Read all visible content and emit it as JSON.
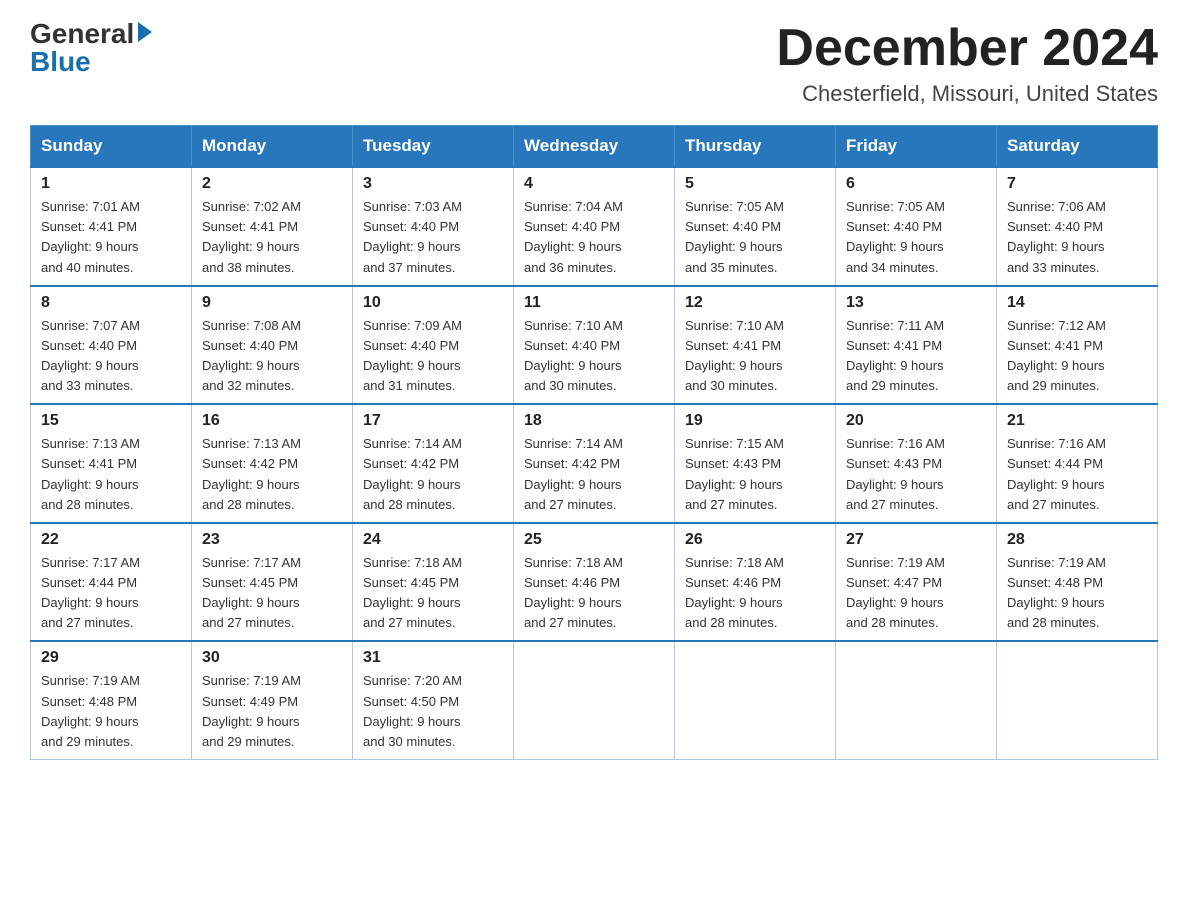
{
  "logo": {
    "general": "General",
    "blue": "Blue"
  },
  "title": {
    "month": "December 2024",
    "location": "Chesterfield, Missouri, United States"
  },
  "weekdays": [
    "Sunday",
    "Monday",
    "Tuesday",
    "Wednesday",
    "Thursday",
    "Friday",
    "Saturday"
  ],
  "weeks": [
    [
      {
        "day": "1",
        "sunrise": "7:01 AM",
        "sunset": "4:41 PM",
        "daylight": "9 hours and 40 minutes."
      },
      {
        "day": "2",
        "sunrise": "7:02 AM",
        "sunset": "4:41 PM",
        "daylight": "9 hours and 38 minutes."
      },
      {
        "day": "3",
        "sunrise": "7:03 AM",
        "sunset": "4:40 PM",
        "daylight": "9 hours and 37 minutes."
      },
      {
        "day": "4",
        "sunrise": "7:04 AM",
        "sunset": "4:40 PM",
        "daylight": "9 hours and 36 minutes."
      },
      {
        "day": "5",
        "sunrise": "7:05 AM",
        "sunset": "4:40 PM",
        "daylight": "9 hours and 35 minutes."
      },
      {
        "day": "6",
        "sunrise": "7:05 AM",
        "sunset": "4:40 PM",
        "daylight": "9 hours and 34 minutes."
      },
      {
        "day": "7",
        "sunrise": "7:06 AM",
        "sunset": "4:40 PM",
        "daylight": "9 hours and 33 minutes."
      }
    ],
    [
      {
        "day": "8",
        "sunrise": "7:07 AM",
        "sunset": "4:40 PM",
        "daylight": "9 hours and 33 minutes."
      },
      {
        "day": "9",
        "sunrise": "7:08 AM",
        "sunset": "4:40 PM",
        "daylight": "9 hours and 32 minutes."
      },
      {
        "day": "10",
        "sunrise": "7:09 AM",
        "sunset": "4:40 PM",
        "daylight": "9 hours and 31 minutes."
      },
      {
        "day": "11",
        "sunrise": "7:10 AM",
        "sunset": "4:40 PM",
        "daylight": "9 hours and 30 minutes."
      },
      {
        "day": "12",
        "sunrise": "7:10 AM",
        "sunset": "4:41 PM",
        "daylight": "9 hours and 30 minutes."
      },
      {
        "day": "13",
        "sunrise": "7:11 AM",
        "sunset": "4:41 PM",
        "daylight": "9 hours and 29 minutes."
      },
      {
        "day": "14",
        "sunrise": "7:12 AM",
        "sunset": "4:41 PM",
        "daylight": "9 hours and 29 minutes."
      }
    ],
    [
      {
        "day": "15",
        "sunrise": "7:13 AM",
        "sunset": "4:41 PM",
        "daylight": "9 hours and 28 minutes."
      },
      {
        "day": "16",
        "sunrise": "7:13 AM",
        "sunset": "4:42 PM",
        "daylight": "9 hours and 28 minutes."
      },
      {
        "day": "17",
        "sunrise": "7:14 AM",
        "sunset": "4:42 PM",
        "daylight": "9 hours and 28 minutes."
      },
      {
        "day": "18",
        "sunrise": "7:14 AM",
        "sunset": "4:42 PM",
        "daylight": "9 hours and 27 minutes."
      },
      {
        "day": "19",
        "sunrise": "7:15 AM",
        "sunset": "4:43 PM",
        "daylight": "9 hours and 27 minutes."
      },
      {
        "day": "20",
        "sunrise": "7:16 AM",
        "sunset": "4:43 PM",
        "daylight": "9 hours and 27 minutes."
      },
      {
        "day": "21",
        "sunrise": "7:16 AM",
        "sunset": "4:44 PM",
        "daylight": "9 hours and 27 minutes."
      }
    ],
    [
      {
        "day": "22",
        "sunrise": "7:17 AM",
        "sunset": "4:44 PM",
        "daylight": "9 hours and 27 minutes."
      },
      {
        "day": "23",
        "sunrise": "7:17 AM",
        "sunset": "4:45 PM",
        "daylight": "9 hours and 27 minutes."
      },
      {
        "day": "24",
        "sunrise": "7:18 AM",
        "sunset": "4:45 PM",
        "daylight": "9 hours and 27 minutes."
      },
      {
        "day": "25",
        "sunrise": "7:18 AM",
        "sunset": "4:46 PM",
        "daylight": "9 hours and 27 minutes."
      },
      {
        "day": "26",
        "sunrise": "7:18 AM",
        "sunset": "4:46 PM",
        "daylight": "9 hours and 28 minutes."
      },
      {
        "day": "27",
        "sunrise": "7:19 AM",
        "sunset": "4:47 PM",
        "daylight": "9 hours and 28 minutes."
      },
      {
        "day": "28",
        "sunrise": "7:19 AM",
        "sunset": "4:48 PM",
        "daylight": "9 hours and 28 minutes."
      }
    ],
    [
      {
        "day": "29",
        "sunrise": "7:19 AM",
        "sunset": "4:48 PM",
        "daylight": "9 hours and 29 minutes."
      },
      {
        "day": "30",
        "sunrise": "7:19 AM",
        "sunset": "4:49 PM",
        "daylight": "9 hours and 29 minutes."
      },
      {
        "day": "31",
        "sunrise": "7:20 AM",
        "sunset": "4:50 PM",
        "daylight": "9 hours and 30 minutes."
      },
      null,
      null,
      null,
      null
    ]
  ],
  "labels": {
    "sunrise": "Sunrise:",
    "sunset": "Sunset:",
    "daylight": "Daylight:"
  }
}
